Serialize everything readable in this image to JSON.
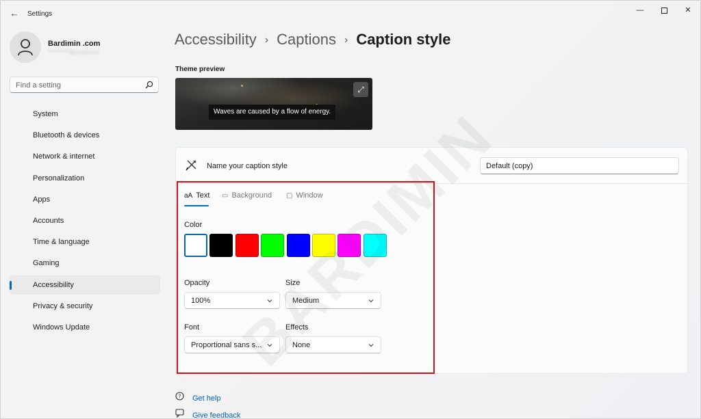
{
  "window": {
    "title": "Settings",
    "controls": {
      "minimize": "—",
      "close": "✕"
    }
  },
  "user": {
    "name": "Bardimin .com",
    "email": "**********@gmail.com"
  },
  "search": {
    "placeholder": "Find a setting"
  },
  "sidebar": {
    "items": [
      {
        "label": "System"
      },
      {
        "label": "Bluetooth & devices"
      },
      {
        "label": "Network & internet"
      },
      {
        "label": "Personalization"
      },
      {
        "label": "Apps"
      },
      {
        "label": "Accounts"
      },
      {
        "label": "Time & language"
      },
      {
        "label": "Gaming"
      },
      {
        "label": "Accessibility",
        "active": true
      },
      {
        "label": "Privacy & security"
      },
      {
        "label": "Windows Update"
      }
    ]
  },
  "breadcrumb": {
    "items": [
      "Accessibility",
      "Captions"
    ],
    "separator": "›",
    "current": "Caption style"
  },
  "preview": {
    "label": "Theme preview",
    "caption": "Waves are caused by a flow of energy.",
    "expand_icon": "⤢"
  },
  "caption_style": {
    "name_label": "Name your caption style",
    "name_value": "Default (copy)"
  },
  "tabs": [
    {
      "icon": "aA",
      "label": "Text",
      "active": true
    },
    {
      "icon": "▭",
      "label": "Background"
    },
    {
      "icon": "▢",
      "label": "Window"
    }
  ],
  "color": {
    "label": "Color",
    "swatches": [
      "#ffffff",
      "#000000",
      "#ff0000",
      "#00ff00",
      "#0000ff",
      "#ffff00",
      "#ff00ff",
      "#00ffff"
    ],
    "selected": "#ffffff"
  },
  "opacity": {
    "label": "Opacity",
    "value": "100%"
  },
  "size": {
    "label": "Size",
    "value": "Medium"
  },
  "font": {
    "label": "Font",
    "value": "Proportional sans s..."
  },
  "effects": {
    "label": "Effects",
    "value": "None"
  },
  "help": {
    "get_help": "Get help",
    "give_feedback": "Give feedback"
  },
  "watermark": "BARDIMIN",
  "colors": {
    "accent": "#0067c0",
    "highlight": "#d3111b"
  }
}
